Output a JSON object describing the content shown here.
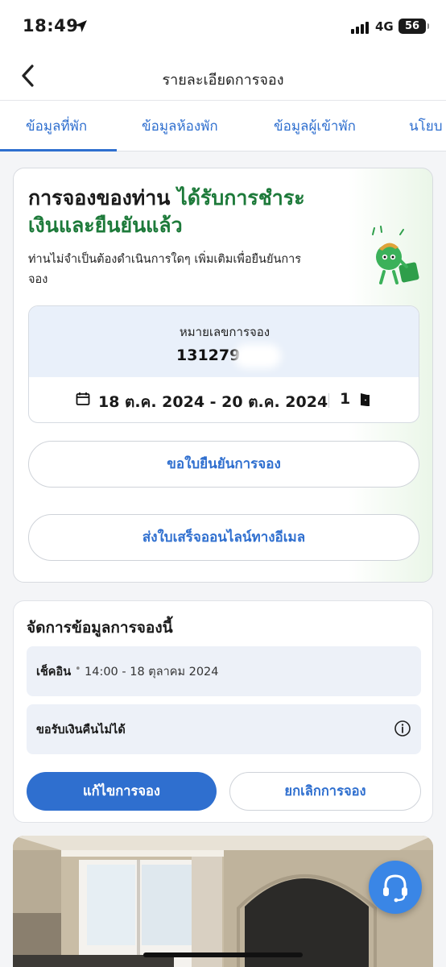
{
  "status_bar": {
    "time": "18:49",
    "network": "4G",
    "battery": "56"
  },
  "header": {
    "title": "รายละเอียดการจอง"
  },
  "tabs": [
    {
      "label": "ข้อมูลที่พัก"
    },
    {
      "label": "ข้อมูลห้องพัก"
    },
    {
      "label": "ข้อมูลผู้เข้าพัก"
    },
    {
      "label": "นโยบ"
    }
  ],
  "confirmation": {
    "heading_prefix": "การจองของท่าน",
    "heading_highlight_line1": "ได้รับการชำระ",
    "heading_highlight_line2": "เงินและยืนยันแล้ว",
    "subtitle_line1": "ท่านไม่จำเป็นต้องดำเนินการใดๆ เพิ่มเติมเพื่อยืนยันการ",
    "subtitle_line2": "จอง",
    "booking_number_label": "หมายเลขการจอง",
    "booking_number": "131279",
    "dates": "18 ต.ค. 2024 - 20 ต.ค. 2024",
    "room_count": "1",
    "request_confirmation_button": "ขอใบยืนยันการจอง",
    "email_receipt_button": "ส่งใบเสร็จออนไลน์ทางอีเมล"
  },
  "manage": {
    "title": "จัดการข้อมูลการจองนี้",
    "checkin_label": "เช็คอิน",
    "checkin_value": "14:00 - 18 ตุลาคม 2024",
    "refund_label": "ขอรับเงินคืนไม่ได้",
    "edit_button": "แก้ไขการจอง",
    "cancel_button": "ยกเลิกการจอง"
  },
  "colors": {
    "accent_blue": "#2f6fcf",
    "confirm_green": "#1d7a3a",
    "fab_blue": "#3a86e6"
  }
}
